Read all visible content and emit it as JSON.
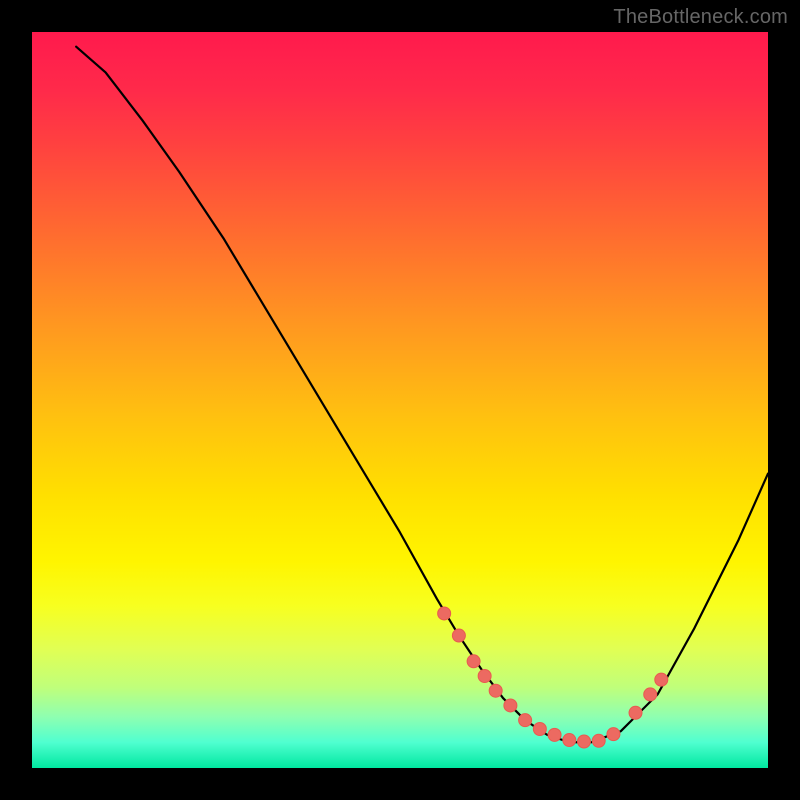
{
  "watermark": "TheBottleneck.com",
  "chart_data": {
    "type": "line",
    "title": "",
    "xlabel": "",
    "ylabel": "",
    "xlim": [
      0,
      100
    ],
    "ylim": [
      0,
      100
    ],
    "curve": {
      "x": [
        6,
        10,
        15,
        20,
        26,
        32,
        38,
        44,
        50,
        55,
        58,
        61,
        64,
        67,
        70,
        73,
        76,
        80,
        85,
        90,
        96,
        100
      ],
      "y": [
        98,
        94.5,
        88,
        81,
        72,
        62,
        52,
        42,
        32,
        23,
        18,
        13.5,
        9.5,
        6.5,
        4.5,
        3.5,
        3.5,
        5,
        10,
        19,
        31,
        40
      ]
    },
    "points": {
      "x": [
        56,
        58,
        60,
        61.5,
        63,
        65,
        67,
        69,
        71,
        73,
        75,
        77,
        79,
        82,
        84,
        85.5
      ],
      "y": [
        21,
        18,
        14.5,
        12.5,
        10.5,
        8.5,
        6.5,
        5.3,
        4.5,
        3.8,
        3.6,
        3.7,
        4.6,
        7.5,
        10,
        12
      ]
    },
    "colors": {
      "curve": "#000000",
      "points_fill": "#ec6a61",
      "points_stroke": "#e95a50"
    },
    "grid": false,
    "legend": false
  }
}
